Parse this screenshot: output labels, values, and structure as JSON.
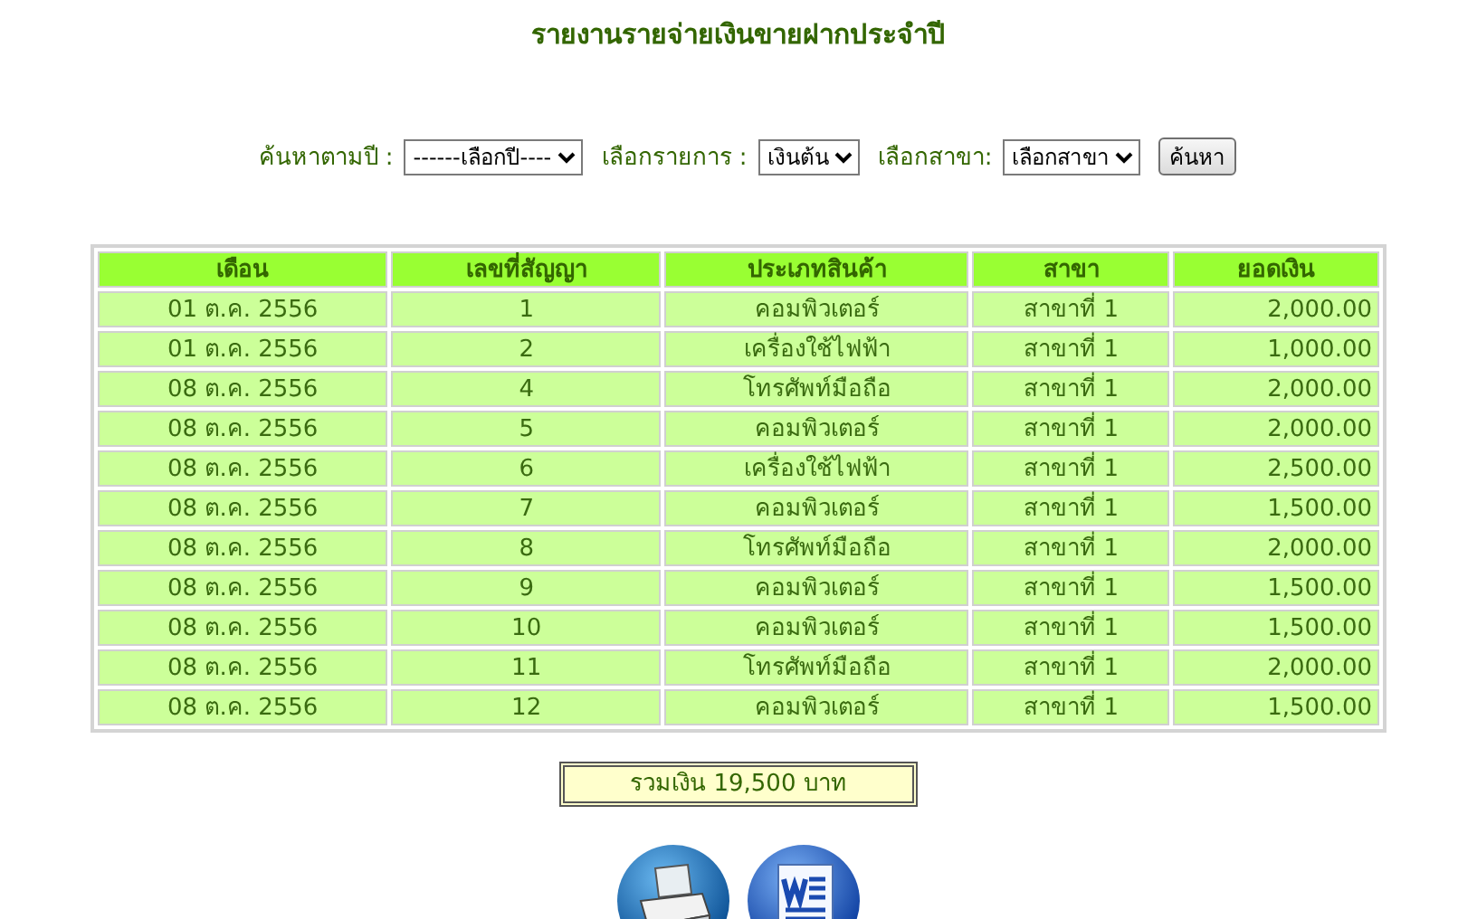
{
  "title": "รายงานรายจ่ายเงินขายฝากประจำปี",
  "filters": [
    {
      "label": "ค้นหาตามปี :",
      "value": "------เลือกปี----"
    },
    {
      "label": "เลือกรายการ :",
      "value": "เงินต้น"
    },
    {
      "label": "เลือกสาขา:",
      "value": "เลือกสาขา"
    }
  ],
  "search_button": "ค้นหา",
  "table": {
    "columns": [
      "เดือน",
      "เลขที่สัญญา",
      "ประเภทสินค้า",
      "สาขา",
      "ยอดเงิน"
    ],
    "rows": [
      [
        "01 ต.ค. 2556",
        "1",
        "คอมพิวเตอร์",
        "สาขาที่ 1",
        "2,000.00"
      ],
      [
        "01 ต.ค. 2556",
        "2",
        "เครื่องใช้ไฟฟ้า",
        "สาขาที่ 1",
        "1,000.00"
      ],
      [
        "08 ต.ค. 2556",
        "4",
        "โทรศัพท์มือถือ",
        "สาขาที่ 1",
        "2,000.00"
      ],
      [
        "08 ต.ค. 2556",
        "5",
        "คอมพิวเตอร์",
        "สาขาที่ 1",
        "2,000.00"
      ],
      [
        "08 ต.ค. 2556",
        "6",
        "เครื่องใช้ไฟฟ้า",
        "สาขาที่ 1",
        "2,500.00"
      ],
      [
        "08 ต.ค. 2556",
        "7",
        "คอมพิวเตอร์",
        "สาขาที่ 1",
        "1,500.00"
      ],
      [
        "08 ต.ค. 2556",
        "8",
        "โทรศัพท์มือถือ",
        "สาขาที่ 1",
        "2,000.00"
      ],
      [
        "08 ต.ค. 2556",
        "9",
        "คอมพิวเตอร์",
        "สาขาที่ 1",
        "1,500.00"
      ],
      [
        "08 ต.ค. 2556",
        "10",
        "คอมพิวเตอร์",
        "สาขาที่ 1",
        "1,500.00"
      ],
      [
        "08 ต.ค. 2556",
        "11",
        "โทรศัพท์มือถือ",
        "สาขาที่ 1",
        "2,000.00"
      ],
      [
        "08 ต.ค. 2556",
        "12",
        "คอมพิวเตอร์",
        "สาขาที่ 1",
        "1,500.00"
      ]
    ]
  },
  "total": "รวมเงิน 19,500 บาท"
}
